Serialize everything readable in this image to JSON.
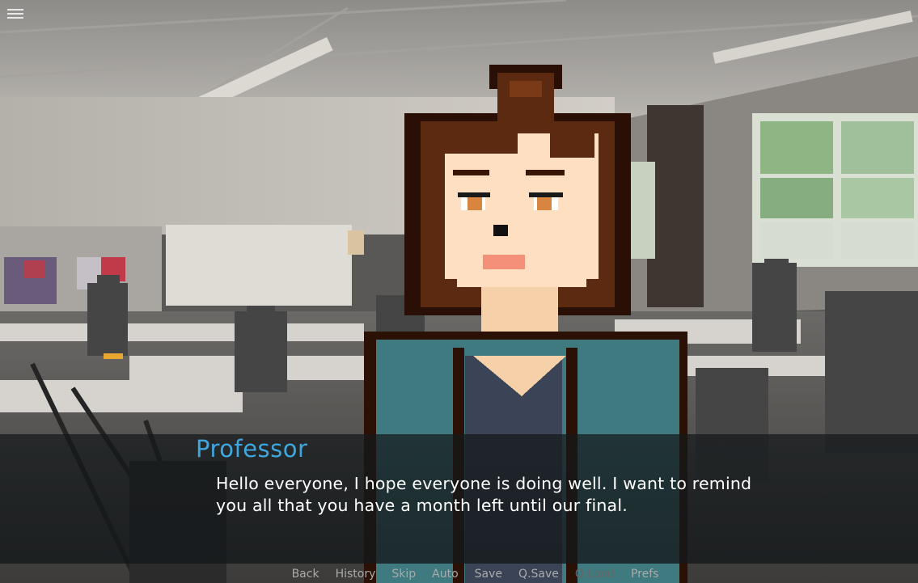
{
  "scene": {
    "background": "classroom",
    "character": "professor-sprite"
  },
  "menu_icon": "hamburger-menu-icon",
  "dialogue": {
    "speaker": "Professor",
    "text_line1": "Hello everyone, I hope everyone is doing well. I want to remind",
    "text_line2": "you all that you have a month left until our final."
  },
  "quick_menu": {
    "back": "Back",
    "history": "History",
    "skip": "Skip",
    "auto": "Auto",
    "save": "Save",
    "qsave": "Q.Save",
    "qload": "Q.Load",
    "prefs": "Prefs"
  },
  "colors": {
    "speaker": "#3fa7df",
    "text": "#ffffff",
    "menu_text": "#aaaaaa",
    "menu_disabled": "#666666"
  }
}
